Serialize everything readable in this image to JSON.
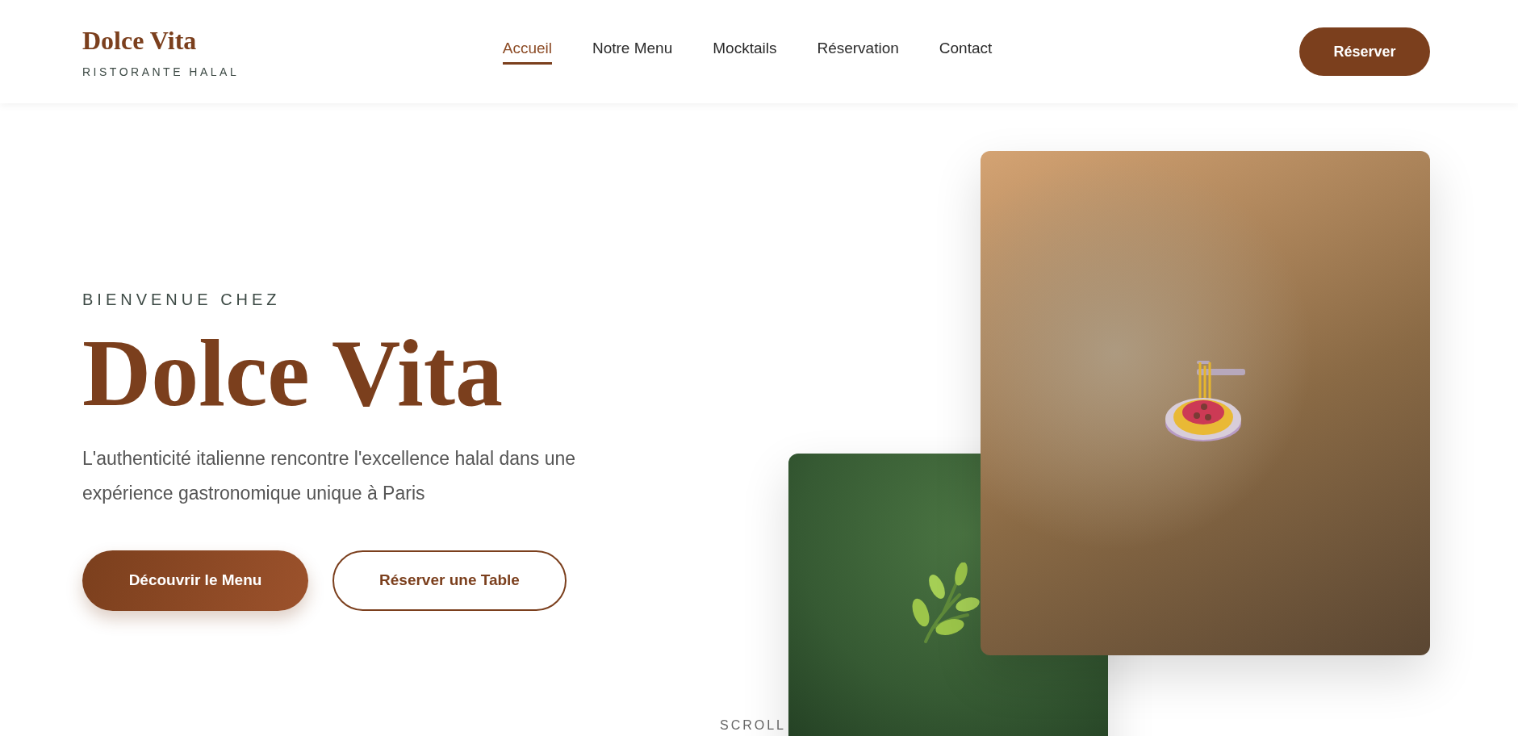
{
  "header": {
    "logo": "Dolce Vita",
    "tagline": "RISTORANTE HALAL",
    "nav": [
      {
        "label": "Accueil",
        "selected": true
      },
      {
        "label": "Notre Menu",
        "selected": false
      },
      {
        "label": "Mocktails",
        "selected": false
      },
      {
        "label": "Réservation",
        "selected": false
      },
      {
        "label": "Contact",
        "selected": false
      }
    ],
    "cta": "Réserver"
  },
  "hero": {
    "eyebrow": "BIENVENUE CHEZ",
    "title": "Dolce Vita",
    "text": "L'authenticité italienne rencontre l'excellence halal dans une expérience gastronomique unique à Paris",
    "buttons": [
      {
        "label": "Découvrir le Menu",
        "kind": "primary"
      },
      {
        "label": "Réserver une Table",
        "kind": "outline"
      }
    ],
    "scroll": "SCROLL"
  }
}
